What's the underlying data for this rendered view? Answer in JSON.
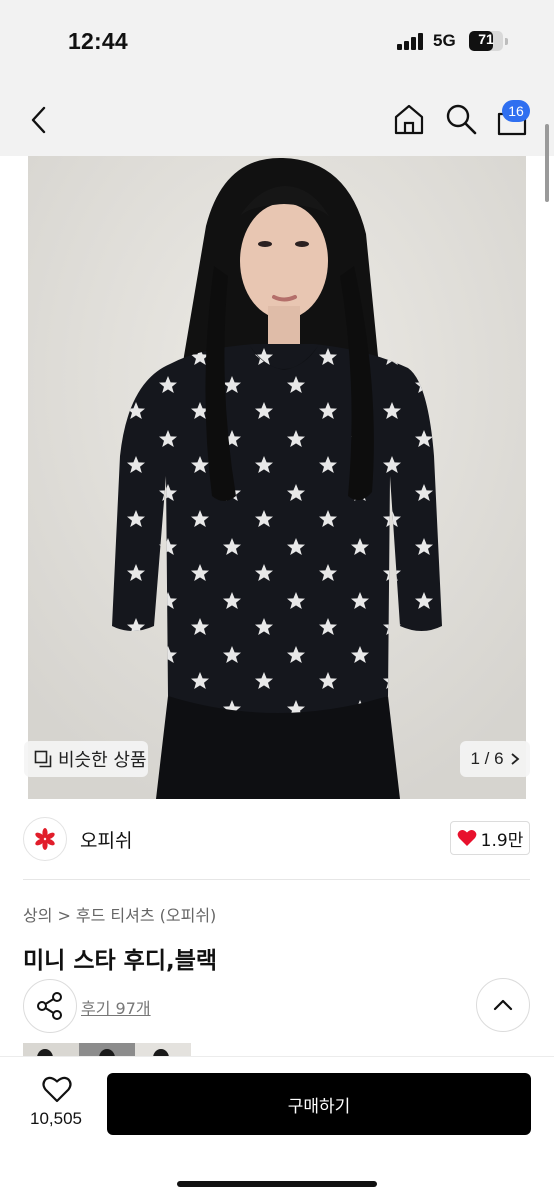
{
  "status_bar": {
    "time": "12:44",
    "network": "5G",
    "battery": "71",
    "battery_level": 0.71
  },
  "header": {
    "cart_badge": "16"
  },
  "gallery": {
    "similar_label": "비슷한 상품",
    "page_indicator": "1 / 6"
  },
  "brand": {
    "name": "오피쉬",
    "likes": "1.9만"
  },
  "product": {
    "breadcrumb": [
      "상의",
      "후드 티셔츠 (오피쉬)"
    ],
    "title": "미니 스타 후디,블랙",
    "reviews": "후기 97개"
  },
  "bottom_bar": {
    "wish_count": "10,505",
    "buy_label": "구매하기"
  },
  "colors": {
    "accent_blue": "#2f6ff0",
    "like_red": "#e8112d",
    "buy_black": "#000000",
    "brand_logo_red": "#e11d2a"
  },
  "icons": [
    "back-icon",
    "home-icon",
    "search-icon",
    "cart-icon",
    "similar-products-icon",
    "chevron-right-icon",
    "heart-icon",
    "share-icon",
    "chevron-up-icon"
  ]
}
